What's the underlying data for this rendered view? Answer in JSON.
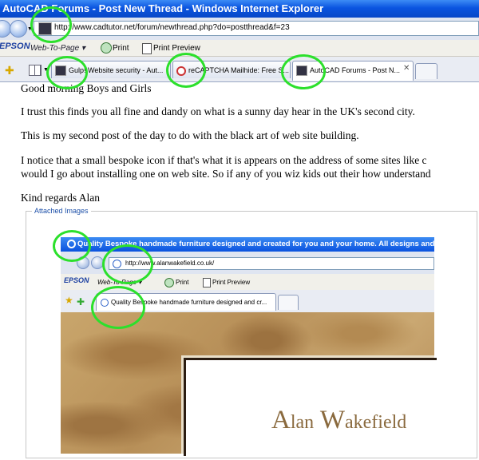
{
  "window": {
    "title": "AutoCAD Forums - Post New Thread - Windows Internet Explorer"
  },
  "address_bar": {
    "url": "http://www.cadtutor.net/forum/newthread.php?do=postthread&f=23"
  },
  "links_toolbar": {
    "brand": "EPSON",
    "web_to_page": "Web-To-Page",
    "print": "Print",
    "print_preview": "Print Preview"
  },
  "tabs": [
    {
      "label": "Gulp! Website security - Aut...",
      "active": false
    },
    {
      "label": "reCAPTCHA Mailhide: Free S...",
      "active": false
    },
    {
      "label": "AutoCAD Forums - Post N...",
      "active": true
    }
  ],
  "post": {
    "greeting": "Good morning Boys and Girls",
    "p1": "I trust this finds you all fine and dandy on what is a sunny day hear in the UK's second city.",
    "p2": "This is my second post of the day to do with the black art of web site building.",
    "p3_line1": "I notice that a small bespoke icon if that's what it is appears on the address of some sites like c",
    "p3_line2": "would I go about installing one on web site. So if any of you wiz kids out their how understand",
    "signoff": "Kind regards Alan"
  },
  "attachments": {
    "label": "Attached Images"
  },
  "embedded_screenshot": {
    "title": "Quality Bespoke handmade furniture designed and created for you and your home. All designs and",
    "url": "http://www.alanwakefield.co.uk/",
    "brand": "EPSON",
    "web_to_page": "Web-To-Page",
    "print": "Print",
    "print_preview": "Print Preview",
    "tab_label": "Quality Bespoke handmade furniture designed and cr...",
    "logo_first_initial": "A",
    "logo_first_rest": "lan",
    "logo_last_initial": "W",
    "logo_last_rest": "akefield"
  },
  "colors": {
    "annotation": "#2ce02c",
    "titlebar": "#0a54e0",
    "logo_text": "#8a6a3e"
  }
}
